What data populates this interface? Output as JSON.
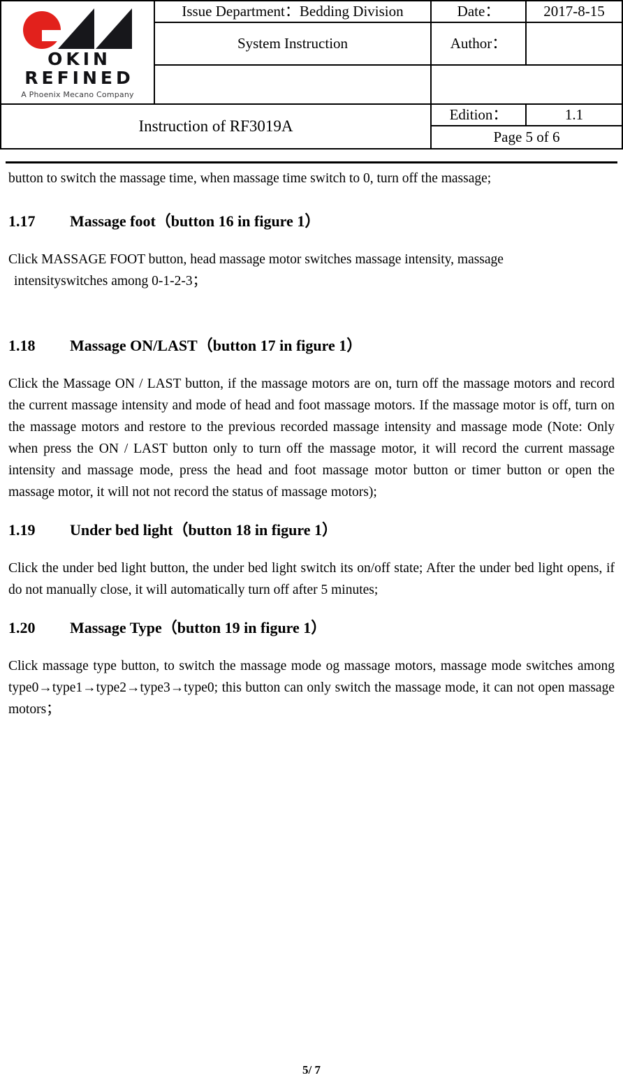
{
  "header": {
    "logo": {
      "word1": "OKIN",
      "word2": "REFINED",
      "tagline": "A Phoenix Mecano Company",
      "red": "#E2211C",
      "black": "#17171B"
    },
    "issue_department": "Issue Department：Bedding Division",
    "date_label": "Date：",
    "date_value": "2017-8-15",
    "doc_type": "System Instruction",
    "author_label": "Author：",
    "author_value": "",
    "blank_left": "",
    "blank_right": "",
    "title": "Instruction of RF3019A",
    "edition_label": "Edition：",
    "edition_value": "1.1",
    "page_label": "Page 5 of 6"
  },
  "body": {
    "lead_paragraph": "button to switch the massage time, when massage time switch to 0, turn off the massage;",
    "sections": [
      {
        "number": "1.17",
        "title": "Massage foot（button 16 in figure 1）",
        "paragraph_line1": "Click  MASSAGE  FOOT  button,  head  massage  motor  switches  massage  intensity,  massage",
        "paragraph_line2": "intensityswitches among 0-1-2-3；"
      },
      {
        "number": "1.18",
        "title": "Massage ON/LAST（button 17 in figure 1）",
        "paragraph": "Click the Massage ON / LAST button, if the massage motors are on, turn off the massage motors and record the current massage intensity and mode of head and foot massage motors. If the massage motor is off, turn on the massage motors and restore to the previous recorded massage intensity and massage mode (Note: Only when press the ON / LAST button only to turn off the massage motor, it will record the current massage intensity and massage mode, press the head and foot massage motor button or timer button or open the massage motor, it will not not record the status of massage motors);"
      },
      {
        "number": "1.19",
        "title": "Under bed light（button 18 in figure 1）",
        "paragraph": "Click the under bed light button, the under bed light switch its on/off state; After the under bed light opens, if do not manually close, it will automatically turn off after 5 minutes;"
      },
      {
        "number": "1.20",
        "title": "Massage Type（button 19 in figure 1）",
        "paragraph": "Click massage type button, to switch the massage mode og massage motors,   massage mode switches among type0→type1→type2→type3→type0; this button can only switch the massage mode, it can not open massage motors；"
      }
    ]
  },
  "footer": {
    "page_number": "5/ 7"
  }
}
